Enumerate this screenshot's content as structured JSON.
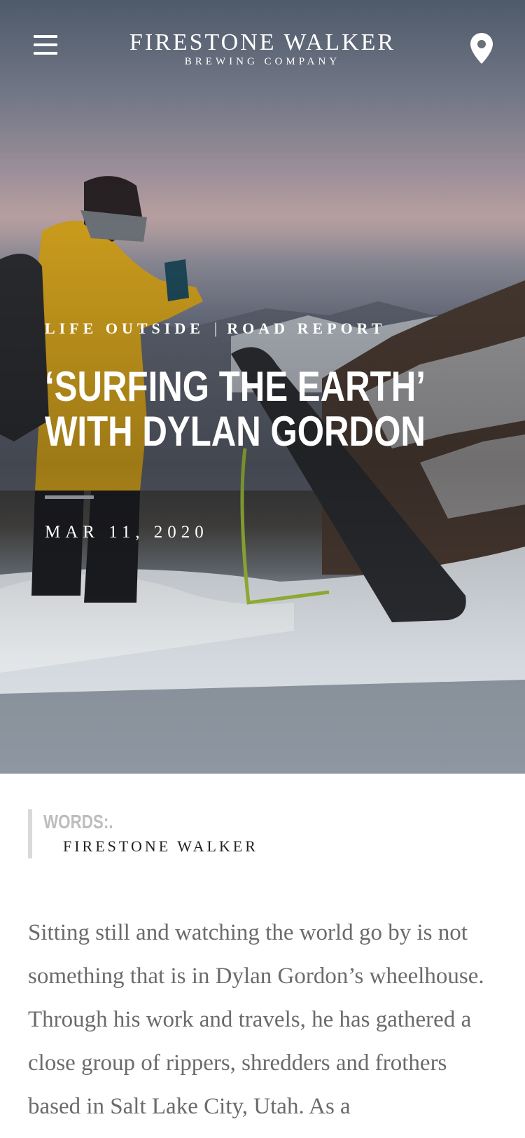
{
  "header": {
    "logo_main": "FIRESTONE  WALKER",
    "logo_sub": "BREWING COMPANY",
    "menu_icon": "hamburger-menu-icon",
    "location_icon": "map-pin-icon"
  },
  "hero": {
    "categories": [
      "LIFE OUTSIDE",
      "ROAD REPORT"
    ],
    "separator": "|",
    "title": "‘SURFING THE EARTH’ WITH DYLAN GORDON",
    "date": "MAR 11, 2020"
  },
  "byline": {
    "label": "WORDS:.",
    "author": "FIRESTONE WALKER"
  },
  "body": {
    "intro": "Sitting still and watching the world go by is not something that is in Dylan Gordon’s wheelhouse. Through his work and travels, he has gathered a close group of rippers, shredders and frothers based in Salt Lake City, Utah. As a"
  },
  "colors": {
    "accent_rule": "#8b8e93",
    "byline_border": "#d9d9d9",
    "body_text": "#6b6b6b"
  }
}
